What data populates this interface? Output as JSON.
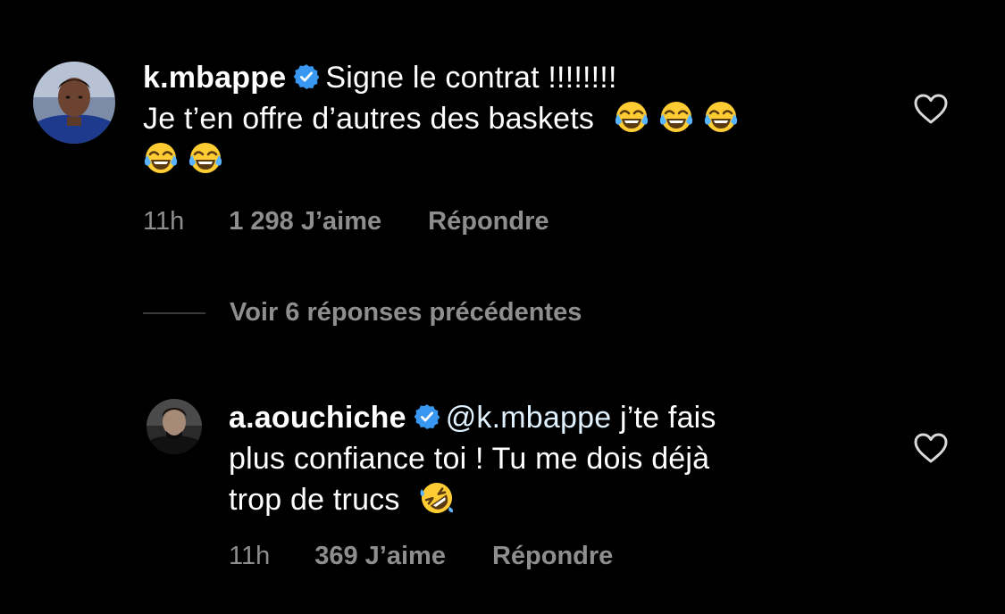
{
  "comments": [
    {
      "username": "k.mbappe",
      "verified": true,
      "text_line1": "Signe le contrat !!!!!!!!",
      "text_line2": "Je t’en offre d’autres des baskets",
      "emojis": [
        "tears-of-joy",
        "tears-of-joy",
        "tears-of-joy",
        "tears-of-joy",
        "tears-of-joy"
      ],
      "time": "11h",
      "likes": "1 298 J’aime",
      "reply": "Répondre"
    },
    {
      "username": "a.aouchiche",
      "verified": true,
      "mention": "@k.mbappe",
      "text_line1": "j’te fais",
      "text_line2": "plus confiance toi ! Tu me dois déjà",
      "text_line3": "trop de trucs",
      "emojis": [
        "rolling-on-floor-laughing"
      ],
      "time": "11h",
      "likes": "369 J’aime",
      "reply": "Répondre"
    }
  ],
  "view_replies": "Voir 6 réponses précédentes",
  "colors": {
    "background": "#000000",
    "text": "#ffffff",
    "secondary_text": "#8e8e8e",
    "verified_badge": "#3897f0",
    "mention": "#e0f1ff"
  },
  "icons": {
    "like": "heart-outline-icon",
    "verified": "verified-badge-icon"
  }
}
